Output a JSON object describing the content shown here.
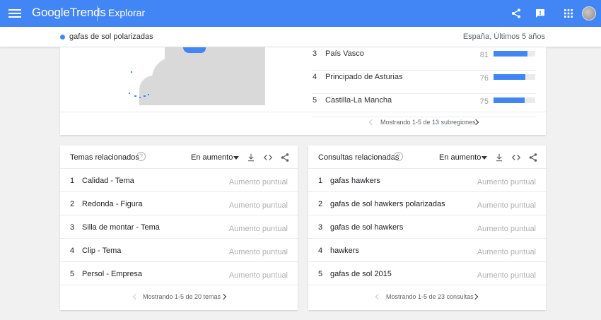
{
  "header": {
    "logo_google": "Google",
    "logo_trends": "Trends",
    "page_title": "Explorar"
  },
  "subheader": {
    "term": "gafas de sol polarizadas",
    "scope": "España, Últimos 5 años",
    "term_color": "#4285f4"
  },
  "regions": {
    "rows": [
      {
        "rank": "3",
        "name": "País Vasco",
        "value": "81",
        "level": 81
      },
      {
        "rank": "4",
        "name": "Principado de Asturias",
        "value": "76",
        "level": 76
      },
      {
        "rank": "5",
        "name": "Castilla-La Mancha",
        "value": "75",
        "level": 75
      }
    ],
    "pager_text": "Mostrando 1-5 de 13 subregiones"
  },
  "topics": {
    "title": "Temas relacionados",
    "filter": "En aumento",
    "rows": [
      {
        "rank": "1",
        "name": "Calidad - Tema",
        "value": "Aumento puntual"
      },
      {
        "rank": "2",
        "name": "Redonda - Figura",
        "value": "Aumento puntual"
      },
      {
        "rank": "3",
        "name": "Silla de montar - Tema",
        "value": "Aumento puntual"
      },
      {
        "rank": "4",
        "name": "Clip - Tema",
        "value": "Aumento puntual"
      },
      {
        "rank": "5",
        "name": "Persol - Empresa",
        "value": "Aumento puntual"
      }
    ],
    "pager_text": "Mostrando 1-5 de 20 temas"
  },
  "queries": {
    "title": "Consultas relacionadas",
    "filter": "En aumento",
    "rows": [
      {
        "rank": "1",
        "name": "gafas hawkers",
        "value": "Aumento puntual"
      },
      {
        "rank": "2",
        "name": "gafas de sol hawkers polarizadas",
        "value": "Aumento puntual"
      },
      {
        "rank": "3",
        "name": "gafas de sol hawkers",
        "value": "Aumento puntual"
      },
      {
        "rank": "4",
        "name": "hawkers",
        "value": "Aumento puntual"
      },
      {
        "rank": "5",
        "name": "gafas de sol 2015",
        "value": "Aumento puntual"
      }
    ],
    "pager_text": "Mostrando 1-5 de 23 consultas"
  },
  "icons": {
    "menu": "menu-icon",
    "share": "share-icon",
    "feedback": "feedback-icon",
    "apps": "apps-grid-icon",
    "help": "help-circle-icon",
    "download": "download-icon",
    "embed": "embed-code-icon"
  }
}
